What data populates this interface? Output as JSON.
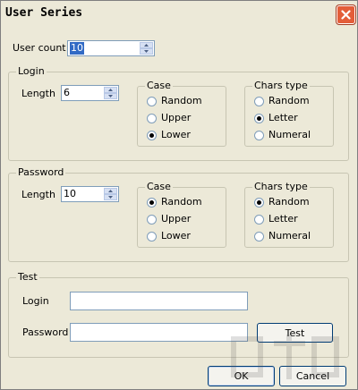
{
  "window": {
    "title": "User Series"
  },
  "user_count": {
    "label": "User count",
    "value": "10"
  },
  "login": {
    "group_label": "Login",
    "length_label": "Length",
    "length_value": "6",
    "case": {
      "label": "Case",
      "options": [
        "Random",
        "Upper",
        "Lower"
      ],
      "selected": "Lower"
    },
    "chars": {
      "label": "Chars type",
      "options": [
        "Random",
        "Letter",
        "Numeral"
      ],
      "selected": "Letter"
    }
  },
  "password": {
    "group_label": "Password",
    "length_label": "Length",
    "length_value": "10",
    "case": {
      "label": "Case",
      "options": [
        "Random",
        "Upper",
        "Lower"
      ],
      "selected": "Random"
    },
    "chars": {
      "label": "Chars type",
      "options": [
        "Random",
        "Letter",
        "Numeral"
      ],
      "selected": "Random"
    }
  },
  "test": {
    "group_label": "Test",
    "login_label": "Login",
    "login_value": "",
    "password_label": "Password",
    "password_value": "",
    "test_button": "Test"
  },
  "buttons": {
    "ok": "OK",
    "cancel": "Cancel"
  },
  "colors": {
    "close_button": "#e35d39",
    "selection": "#316ac5",
    "face": "#ece9d8"
  }
}
